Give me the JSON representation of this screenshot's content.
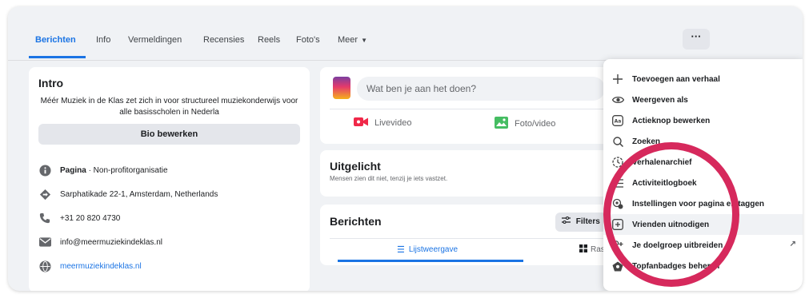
{
  "tabs": [
    "Berichten",
    "Info",
    "Vermeldingen",
    "Recensies",
    "Reels",
    "Foto's",
    "Meer"
  ],
  "more_button_label": "···",
  "intro": {
    "title": "Intro",
    "bio": "Méér Muziek in de Klas zet zich in voor structureel muziekonderwijs voor alle basisscholen in Nederla",
    "bio_button": "Bio bewerken",
    "page_type_bold": "Pagina",
    "page_type_rest": " · Non-profitorganisatie",
    "address": "Sarphatikade 22-1, Amsterdam, Netherlands",
    "phone": "+31 20 820 4730",
    "email": "info@meermuziekindeklas.nl",
    "website": "meermuziekindeklas.nl"
  },
  "composer": {
    "placeholder": "Wat ben je aan het doen?",
    "live_label": "Livevideo",
    "photo_label": "Foto/video"
  },
  "featured": {
    "title": "Uitgelicht",
    "subtitle": "Mensen zien dit niet, tenzij je iets vastzet."
  },
  "posts": {
    "title": "Berichten",
    "filters_label": "Filters",
    "list_view_label": "Lijstweergave",
    "grid_view_label": "Raste"
  },
  "menu": {
    "items": [
      {
        "label": "Toevoegen aan verhaal",
        "icon": "plus-icon"
      },
      {
        "label": "Weergeven als",
        "icon": "eye-icon"
      },
      {
        "label": "Actieknop bewerken",
        "icon": "action-button-icon"
      },
      {
        "label": "Zoeken",
        "icon": "search-icon"
      },
      {
        "label": "Verhalenarchief",
        "icon": "archive-clock-icon"
      },
      {
        "label": "Activiteitlogboek",
        "icon": "activity-log-icon"
      },
      {
        "label": "Instellingen voor pagina en taggen",
        "icon": "settings-gear-icon"
      },
      {
        "label": "Vrienden uitnodigen",
        "icon": "invite-friends-icon"
      },
      {
        "label": "Je doelgroep uitbreiden",
        "icon": "audience-icon"
      },
      {
        "label": "Topfanbadges beheren",
        "icon": "badge-icon"
      }
    ],
    "external_link_icon": "↗"
  },
  "colors": {
    "accent": "#1b74e4",
    "highlight_circle": "#d6295c",
    "background": "#f0f2f5"
  }
}
